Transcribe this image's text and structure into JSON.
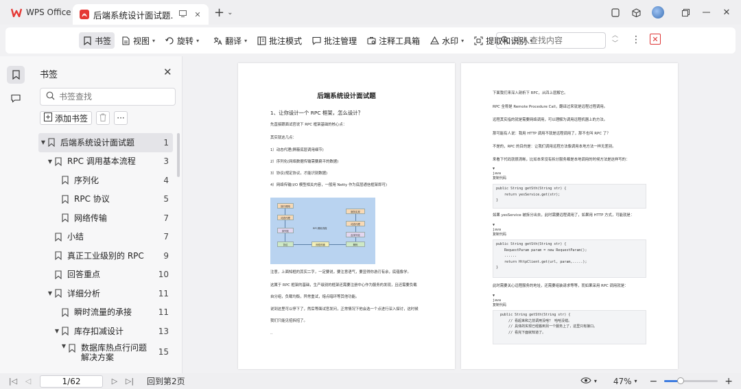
{
  "tabs": {
    "home_label": "WPS Office",
    "doc_label": "后端系统设计面试题.pdf"
  },
  "toolbar": {
    "bookmark": "书签",
    "view": "视图",
    "rotate": "旋转",
    "translate": "翻译",
    "annotate_mode": "批注模式",
    "annotate_manage": "批注管理",
    "annotate_tools": "注释工具箱",
    "watermark": "水印",
    "extract": "提取和识别",
    "search_placeholder": "输入查找内容"
  },
  "bookmark_panel": {
    "title": "书签",
    "search_placeholder": "书签查找",
    "add_label": "添加书签",
    "items": [
      {
        "label": "后端系统设计面试题",
        "page": "1"
      },
      {
        "label": "RPC 调用基本流程",
        "page": "3"
      },
      {
        "label": "序列化",
        "page": "4"
      },
      {
        "label": "RPC 协议",
        "page": "5"
      },
      {
        "label": "网络传输",
        "page": "7"
      },
      {
        "label": "小结",
        "page": "7"
      },
      {
        "label": "真正工业级别的 RPC",
        "page": "9"
      },
      {
        "label": "回答重点",
        "page": "10"
      },
      {
        "label": "详细分析",
        "page": "11"
      },
      {
        "label": "瞬时流量的承接",
        "page": "11"
      },
      {
        "label": "库存扣减设计",
        "page": "13"
      },
      {
        "label": "数据库热点行问题解决方案",
        "page": "15"
      }
    ]
  },
  "page1": {
    "title": "后端系统设计面试题",
    "heading": "1、让你设计一个 RPC 框架，怎么设计？",
    "lines": [
      "先直接跟面试官说下 RPC 框架基础的核心点：",
      "其实就这几点：",
      "1）动态代理(屏蔽底层调用细节)",
      "2）序列化(网络数据传输需要扁平的数据)",
      "3）协议(规定协议，才能识别数据)",
      "4）网络传输(I/O 模型相关内容，一般用 Netty 作为底层通信框架即可)",
      "注意，上面知框的其实二字，一定要说，要注意语气，要显得你游刃有余，底蕴像学。",
      "这属于 RPC 框架的基础，生产级别的框架还需要注册中心作为服务的发现，且还需要负载",
      "自分组，负载均衡，异常重试，熔点暗环等其他功能。",
      "说到这里可以停下了，然后等面试官发问，正常情况下他会选一个点进行深入探讨，这时候",
      "我们只能见招拆招了。"
    ],
    "diagram": {
      "consumer": "接口调用",
      "proxy": "动态代理",
      "serialize": "序列化",
      "protocol": "协议",
      "network": "网络传输",
      "flow_label": "RPC调用流程",
      "server_impl": "服务实现",
      "server_proxy": "动态代理",
      "deserialize": "反序列化",
      "decode": "解码"
    }
  },
  "page2": {
    "lines": [
      "下面我们来深入剖析下 RPC，从四上层解它。",
      "RPC 全称是 Remote Procedure Call，翻译过来就是远程过程调用。",
      "远程其实指的就是需要网络调用，可以理解为调用远程机器上的方法。",
      "那可能有人说：我用 HTTP 调用不就是远程调用了，那不也叫 RPC 了？",
      "不是的，RPC 的目的是：让我们调用远程方法像调用本地方法一样无差别。",
      "来看下代码就很清晰，比如本来没有拆分服务都是本地调用的时候方法是这样写的：",
      "如果 yesService 被拆分出去，此时需要远程调用了，如果用 HTTP 方式，可能就是：",
      "此时需要关心远程服务的地址，还需要组装请求等等，而如果采用 RPC 调用就是："
    ],
    "code1_label": "java\n复制代码",
    "code1": "public String getSth(String str) {\n    return yesService.get(str);\n}",
    "code2_label": "java\n复制代码",
    "code2": "public String getSth(String str) {\n    RequestParam param = new RequestParam();\n    ......\n    return HttpClient.get(url, param,.....);\n}",
    "code3_label": "java\n复制代码",
    "code3": "  public String getSth(String str) {\n      // 看起来和之前调用没啥？ 哈哈没错。\n      // 具体的实现已经搬到另一个服务上了，这里只有接口。\n      // 看完下面就知道了。"
  },
  "status": {
    "page_value": "1/62",
    "back_text": "回到第2页",
    "zoom": "47%",
    "zoom_fraction": 0.3
  }
}
